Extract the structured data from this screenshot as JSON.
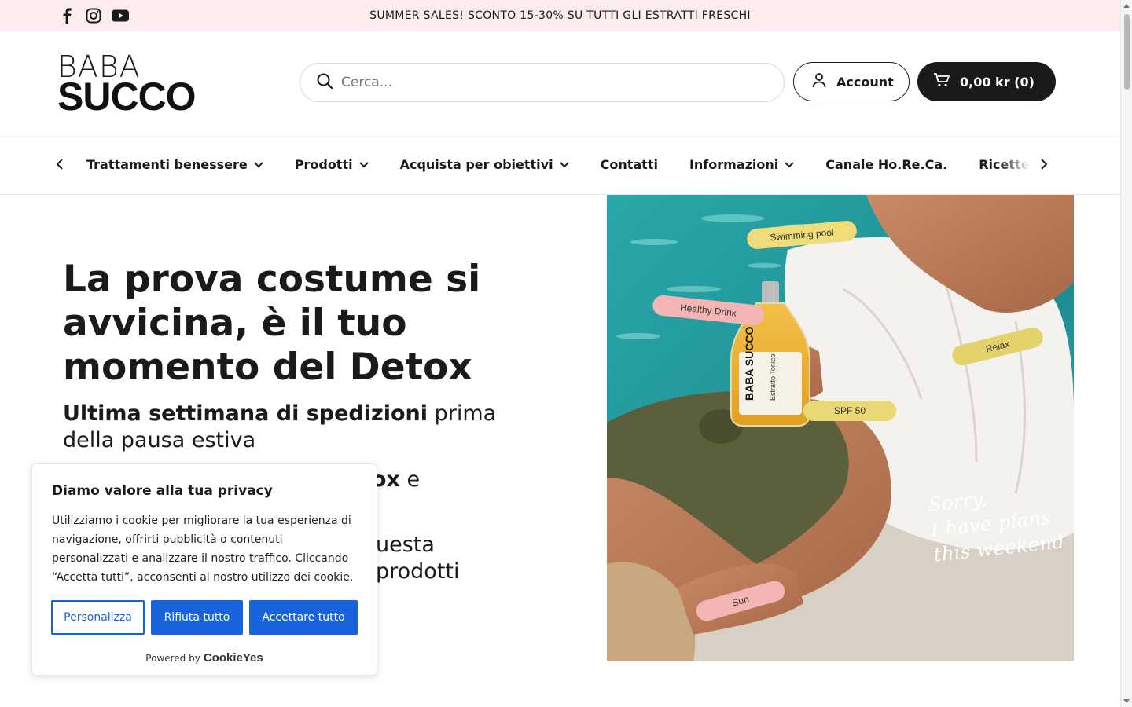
{
  "announcement": {
    "text": "SUMMER SALES! SCONTO 15-30% SU TUTTI GLI ESTRATTI FRESCHI",
    "socials": [
      "facebook-icon",
      "instagram-icon",
      "youtube-icon"
    ]
  },
  "header": {
    "logo_line1": "BABA",
    "logo_line2": "SUCCO",
    "search_placeholder": "Cerca...",
    "account_label": "Account",
    "cart_label": "0,00 kr (0)"
  },
  "nav": {
    "items": [
      {
        "label": "Trattamenti benessere",
        "dropdown": true
      },
      {
        "label": "Prodotti",
        "dropdown": true
      },
      {
        "label": "Acquista per obiettivi",
        "dropdown": true
      },
      {
        "label": "Contatti",
        "dropdown": false
      },
      {
        "label": "Informazioni",
        "dropdown": true
      },
      {
        "label": "Canale Ho.Re.Ca.",
        "dropdown": false
      },
      {
        "label": "Ricette",
        "dropdown": false
      }
    ]
  },
  "hero": {
    "title": "La prova costume si avvicina, è il tuo momento del Detox",
    "subtitle_bold": "Ultima settimana di spedizioni",
    "subtitle_rest": " prima della pausa estiva",
    "p2_bold": "tox",
    "p2_rest": " e",
    "p3_line1": "uesta",
    "p3_line2": "prodotti"
  },
  "image": {
    "tags": [
      "Swimming pool",
      "Healthy Drink",
      "Relax",
      "SPF 50",
      "Sun"
    ],
    "script_lines": [
      "Sorry,",
      "I have plans",
      "this weekend"
    ],
    "bottle_brand": "BABA SUCCO",
    "bottle_label": "Estratto Tonico"
  },
  "cookie": {
    "title": "Diamo valore alla tua privacy",
    "body": "Utilizziamo i cookie per migliorare la tua esperienza di navigazione, offrirti pubblicità o contenuti personalizzati e analizzare il nostro traffico. Cliccando “Accetta tutti”, acconsenti al nostro utilizzo dei cookie.",
    "btn_customize": "Personalizza",
    "btn_reject": "Rifiuta tutto",
    "btn_accept": "Accettare tutto",
    "powered_by": "Powered by",
    "powered_brand": "CookieYes",
    "accent_color": "#1863dc"
  }
}
